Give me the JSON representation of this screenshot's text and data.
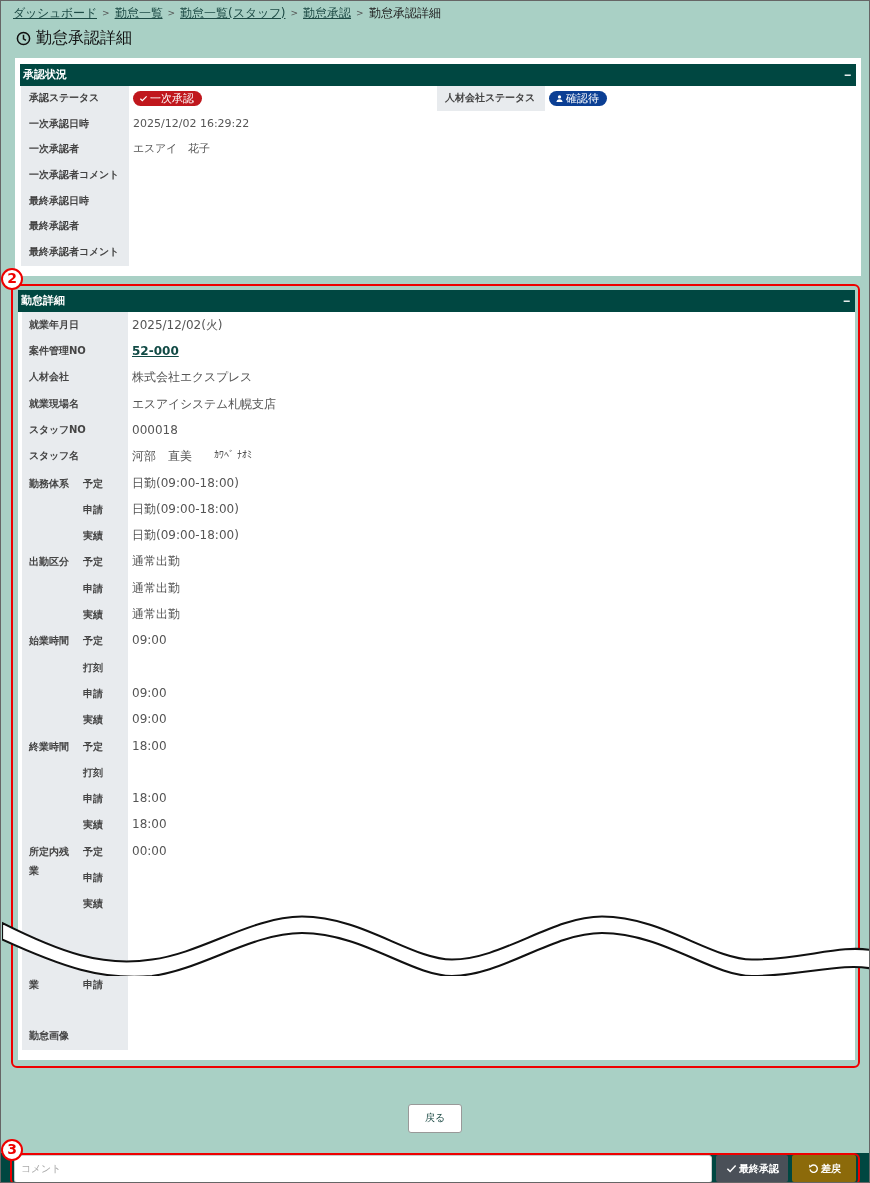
{
  "breadcrumb": [
    {
      "label": "ダッシュボード",
      "link": true
    },
    {
      "label": "勤怠一覧",
      "link": true
    },
    {
      "label": "勤怠一覧(スタッフ)",
      "link": true
    },
    {
      "label": "勤怠承認",
      "link": true
    },
    {
      "label": "勤怠承認詳細",
      "link": false
    }
  ],
  "breadcrumb_separator": ">",
  "page_title": "勤怠承認詳細",
  "approval_panel": {
    "title": "承認状況",
    "collapse": "−",
    "status": {
      "label": "承認ステータス",
      "badge": "一次承認",
      "color": "#c0171d"
    },
    "agency_status": {
      "label": "人材会社ステータス",
      "badge": "確認待",
      "color": "#0b3f94"
    },
    "rows": [
      {
        "label": "一次承認日時",
        "value": "2025/12/02 16:29:22"
      },
      {
        "label": "一次承認者",
        "value": "エスアイ　花子"
      },
      {
        "label": "一次承認者コメント"
      },
      {
        "label": "最終承認日時"
      },
      {
        "label": "最終承認者"
      },
      {
        "label": "最終承認者コメント"
      }
    ]
  },
  "detail_panel": {
    "title": "勤怠詳細",
    "collapse": "−",
    "callout": "2",
    "rows": [
      {
        "kind": "text",
        "label": "就業年月日",
        "value": "2025/12/02(火)"
      },
      {
        "kind": "link",
        "label": "案件管理NO",
        "value": "52-000"
      },
      {
        "kind": "text",
        "label": "人材会社",
        "value": "株式会社エクスプレス"
      },
      {
        "kind": "text",
        "label": "就業現場名",
        "value": "エスアイシステム札幌支店"
      },
      {
        "kind": "text",
        "label": "スタッフNO",
        "value": "000018"
      },
      {
        "kind": "kana",
        "label": "スタッフ名",
        "value": "河部　直美",
        "kana": "ｶﾜﾍﾞ ﾅｵﾐ"
      },
      {
        "kind": "text",
        "label": "勤務体系",
        "sub": "予定",
        "value": "日勤(09:00-18:00)"
      },
      {
        "kind": "text",
        "sub": "申請",
        "value": "日勤(09:00-18:00)"
      },
      {
        "kind": "text",
        "sub": "実績",
        "value": "日勤(09:00-18:00)"
      },
      {
        "kind": "text",
        "label": "出勤区分",
        "sub": "予定",
        "value": "通常出勤"
      },
      {
        "kind": "text",
        "sub": "申請",
        "value": "通常出勤"
      },
      {
        "kind": "text",
        "sub": "実績",
        "value": "通常出勤"
      },
      {
        "kind": "text",
        "label": "始業時間",
        "sub": "予定",
        "value": "09:00"
      },
      {
        "kind": "text",
        "sub": "打刻"
      },
      {
        "kind": "text",
        "sub": "申請",
        "value": "09:00"
      },
      {
        "kind": "text",
        "sub": "実績",
        "value": "09:00"
      },
      {
        "kind": "text",
        "label": "終業時間",
        "sub": "予定",
        "value": "18:00"
      },
      {
        "kind": "text",
        "sub": "打刻"
      },
      {
        "kind": "text",
        "sub": "申請",
        "value": "18:00"
      },
      {
        "kind": "text",
        "sub": "実績",
        "value": "18:00"
      },
      {
        "kind": "text",
        "label": "所定内残業",
        "sub": "予定",
        "value": "00:00"
      },
      {
        "kind": "text",
        "sub": "申請"
      },
      {
        "kind": "text",
        "sub": "実績"
      },
      {
        "kind": "break"
      },
      {
        "kind": "text",
        "label": "業",
        "sub": "申請"
      },
      {
        "kind": "text"
      },
      {
        "kind": "text",
        "label": "勤怠画像"
      }
    ]
  },
  "back_button": "戻る",
  "footer": {
    "callout": "3",
    "comment_placeholder": "コメント",
    "approve_button": "最終承認",
    "reject_button": "差戻"
  }
}
